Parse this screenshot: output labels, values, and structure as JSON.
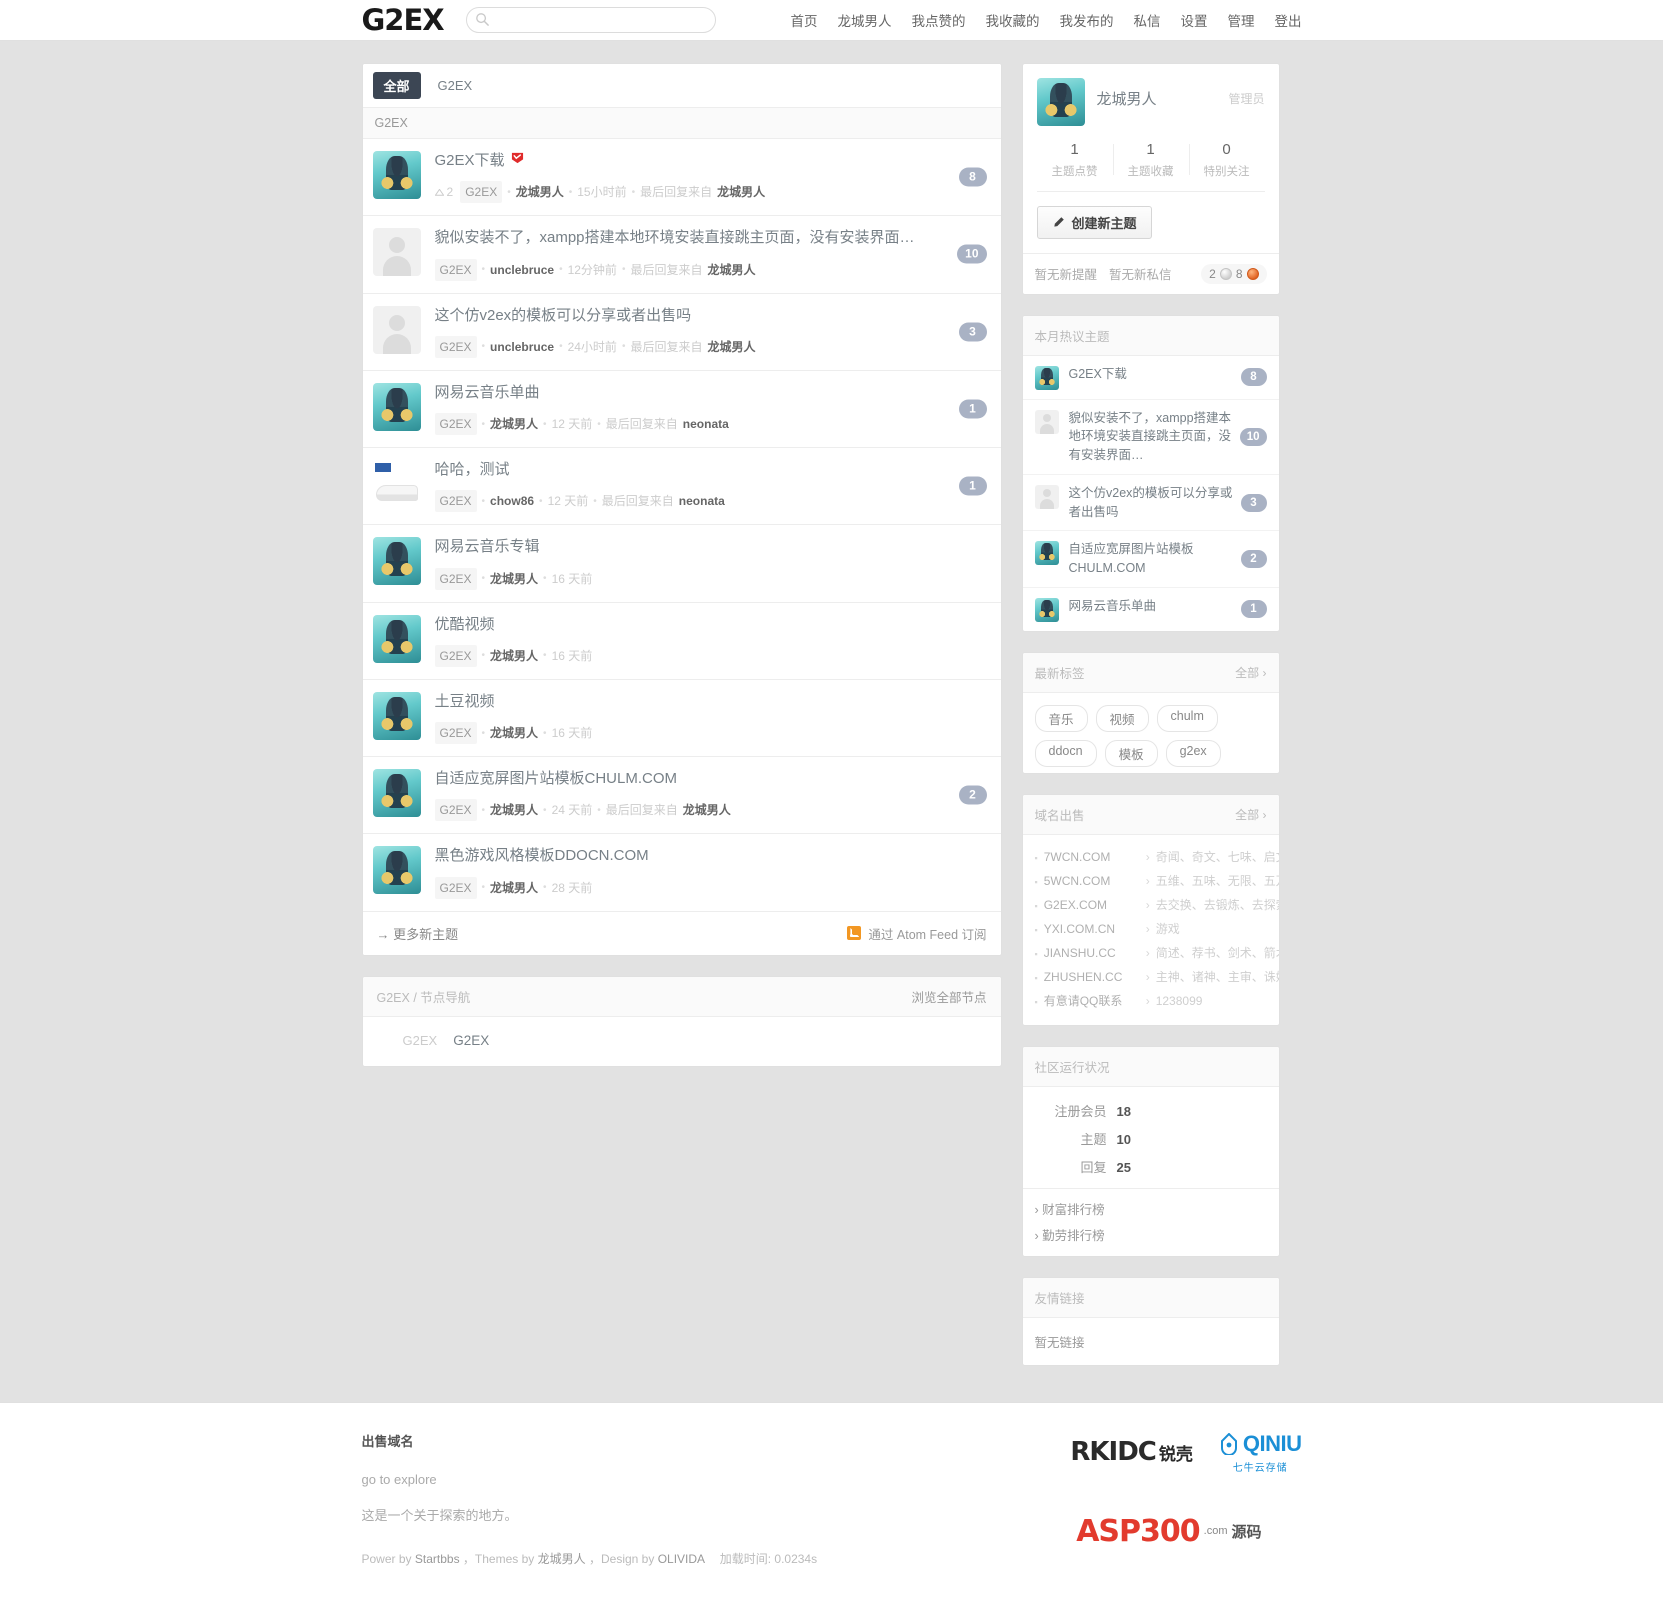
{
  "site": {
    "logo": "G2EX",
    "search_placeholder": ""
  },
  "nav": [
    {
      "label": "首页"
    },
    {
      "label": "龙城男人"
    },
    {
      "label": "我点赞的"
    },
    {
      "label": "我收藏的"
    },
    {
      "label": "我发布的"
    },
    {
      "label": "私信"
    },
    {
      "label": "设置"
    },
    {
      "label": "管理"
    },
    {
      "label": "登出"
    }
  ],
  "main": {
    "tabs": [
      {
        "label": "全部",
        "active": true
      },
      {
        "label": "G2EX",
        "active": false
      }
    ],
    "subbar_label": "G2EX",
    "topics": [
      {
        "title": "G2EX下载",
        "hot": true,
        "avatar": "hero",
        "votes": "2",
        "node": "G2EX",
        "author": "龙城男人",
        "time": "15小时前",
        "last_reply_label": "最后回复来自",
        "last_reply_user": "龙城男人",
        "replies": "8"
      },
      {
        "title": "貌似安装不了，xampp搭建本地环境安装直接跳主页面，没有安装界面…",
        "hot": false,
        "avatar": "anon",
        "votes": "",
        "node": "G2EX",
        "author": "unclebruce",
        "time": "12分钟前",
        "last_reply_label": "最后回复来自",
        "last_reply_user": "龙城男人",
        "replies": "10"
      },
      {
        "title": "这个仿v2ex的模板可以分享或者出售吗",
        "hot": false,
        "avatar": "anon",
        "votes": "",
        "node": "G2EX",
        "author": "unclebruce",
        "time": "24小时前",
        "last_reply_label": "最后回复来自",
        "last_reply_user": "龙城男人",
        "replies": "3"
      },
      {
        "title": "网易云音乐单曲",
        "hot": false,
        "avatar": "hero",
        "votes": "",
        "node": "G2EX",
        "author": "龙城男人",
        "time": "12 天前",
        "last_reply_label": "最后回复来自",
        "last_reply_user": "neonata",
        "replies": "1"
      },
      {
        "title": "哈哈，测试",
        "hot": false,
        "avatar": "shoe",
        "votes": "",
        "node": "G2EX",
        "author": "chow86",
        "time": "12 天前",
        "last_reply_label": "最后回复来自",
        "last_reply_user": "neonata",
        "replies": "1"
      },
      {
        "title": "网易云音乐专辑",
        "hot": false,
        "avatar": "hero",
        "votes": "",
        "node": "G2EX",
        "author": "龙城男人",
        "time": "16 天前",
        "last_reply_label": "",
        "last_reply_user": "",
        "replies": ""
      },
      {
        "title": "优酷视频",
        "hot": false,
        "avatar": "hero",
        "votes": "",
        "node": "G2EX",
        "author": "龙城男人",
        "time": "16 天前",
        "last_reply_label": "",
        "last_reply_user": "",
        "replies": ""
      },
      {
        "title": "土豆视频",
        "hot": false,
        "avatar": "hero",
        "votes": "",
        "node": "G2EX",
        "author": "龙城男人",
        "time": "16 天前",
        "last_reply_label": "",
        "last_reply_user": "",
        "replies": ""
      },
      {
        "title": "自适应宽屏图片站模板CHULM.COM",
        "hot": false,
        "avatar": "hero",
        "votes": "",
        "node": "G2EX",
        "author": "龙城男人",
        "time": "24 天前",
        "last_reply_label": "最后回复来自",
        "last_reply_user": "龙城男人",
        "replies": "2"
      },
      {
        "title": "黑色游戏风格模板DDOCN.COM",
        "hot": false,
        "avatar": "hero",
        "votes": "",
        "node": "G2EX",
        "author": "龙城男人",
        "time": "28 天前",
        "last_reply_label": "",
        "last_reply_user": "",
        "replies": ""
      }
    ],
    "more_topics": "→ 更多新主题",
    "feed_label": "通过 Atom Feed 订阅",
    "nodenav": {
      "title": "G2EX / 节点导航",
      "browse_all": "浏览全部节点",
      "group": "G2EX",
      "nodes": [
        {
          "label": "G2EX"
        }
      ]
    }
  },
  "sidebar": {
    "profile": {
      "username": "龙城男人",
      "role": "管理员",
      "stats": [
        {
          "num": "1",
          "label": "主题点赞"
        },
        {
          "num": "1",
          "label": "主题收藏"
        },
        {
          "num": "0",
          "label": "特别关注"
        }
      ],
      "new_topic_button": "创建新主题",
      "no_notice": "暂无新提醒",
      "no_message": "暂无新私信",
      "coins_silver": "2",
      "coins_bronze": "8"
    },
    "hot_topics": {
      "title": "本月热议主题",
      "items": [
        {
          "title": "G2EX下载",
          "avatar": "hero",
          "count": "8"
        },
        {
          "title": "貌似安装不了，xampp搭建本地环境安装直接跳主页面，没有安装界面…",
          "avatar": "anon",
          "count": "10"
        },
        {
          "title": "这个仿v2ex的模板可以分享或者出售吗",
          "avatar": "anon",
          "count": "3"
        },
        {
          "title": "自适应宽屏图片站模板CHULM.COM",
          "avatar": "hero",
          "count": "2"
        },
        {
          "title": "网易云音乐单曲",
          "avatar": "hero",
          "count": "1"
        }
      ]
    },
    "tags": {
      "title": "最新标签",
      "more": "全部 ›",
      "items": [
        {
          "label": "音乐"
        },
        {
          "label": "视频"
        },
        {
          "label": "chulm"
        },
        {
          "label": "ddocn"
        },
        {
          "label": "模板"
        },
        {
          "label": "g2ex"
        }
      ]
    },
    "domains": {
      "title": "域名出售",
      "more": "全部 ›",
      "items": [
        {
          "name": "7WCN.COM",
          "desc": "奇闻、奇文、七味、启文"
        },
        {
          "name": "5WCN.COM",
          "desc": "五维、五味、无限、五万"
        },
        {
          "name": "G2EX.COM",
          "desc": "去交换、去锻炼、去探索"
        },
        {
          "name": "YXI.COM.CN",
          "desc": "游戏"
        },
        {
          "name": "JIANSHU.CC",
          "desc": "简述、荐书、剑术、箭术"
        },
        {
          "name": "ZHUSHEN.CC",
          "desc": "主神、诸神、主审、诛婶"
        },
        {
          "name": "有意请QQ联系",
          "desc": "1238099"
        }
      ]
    },
    "community": {
      "title": "社区运行状况",
      "stats": [
        {
          "key": "注册会员",
          "value": "18"
        },
        {
          "key": "主题",
          "value": "10"
        },
        {
          "key": "回复",
          "value": "25"
        }
      ],
      "links": [
        {
          "label": "› 财富排行榜"
        },
        {
          "label": "› 勤劳排行榜"
        }
      ]
    },
    "friend_links": {
      "title": "友情链接",
      "empty": "暂无链接"
    }
  },
  "footer": {
    "title": "出售域名",
    "line1": "go to explore",
    "line2": "这是一个关于探索的地方。",
    "credit_prefix": "Power by",
    "credit_startbbs": "Startbbs",
    "credit_themes": "，Themes by",
    "credit_theme_author": "龙城男人",
    "credit_design": "，Design by",
    "credit_designer": "OLIVIDA",
    "credit_load": "加载时间: 0.0234s",
    "logo_rkidc": "RKIDC",
    "logo_rkidc_cn": "锐壳",
    "logo_qiniu": "QINIU",
    "logo_qiniu_cn": "七牛云存储",
    "watermark_main": "ASP300",
    "watermark_sub": ".com",
    "watermark_cn": "源码"
  }
}
